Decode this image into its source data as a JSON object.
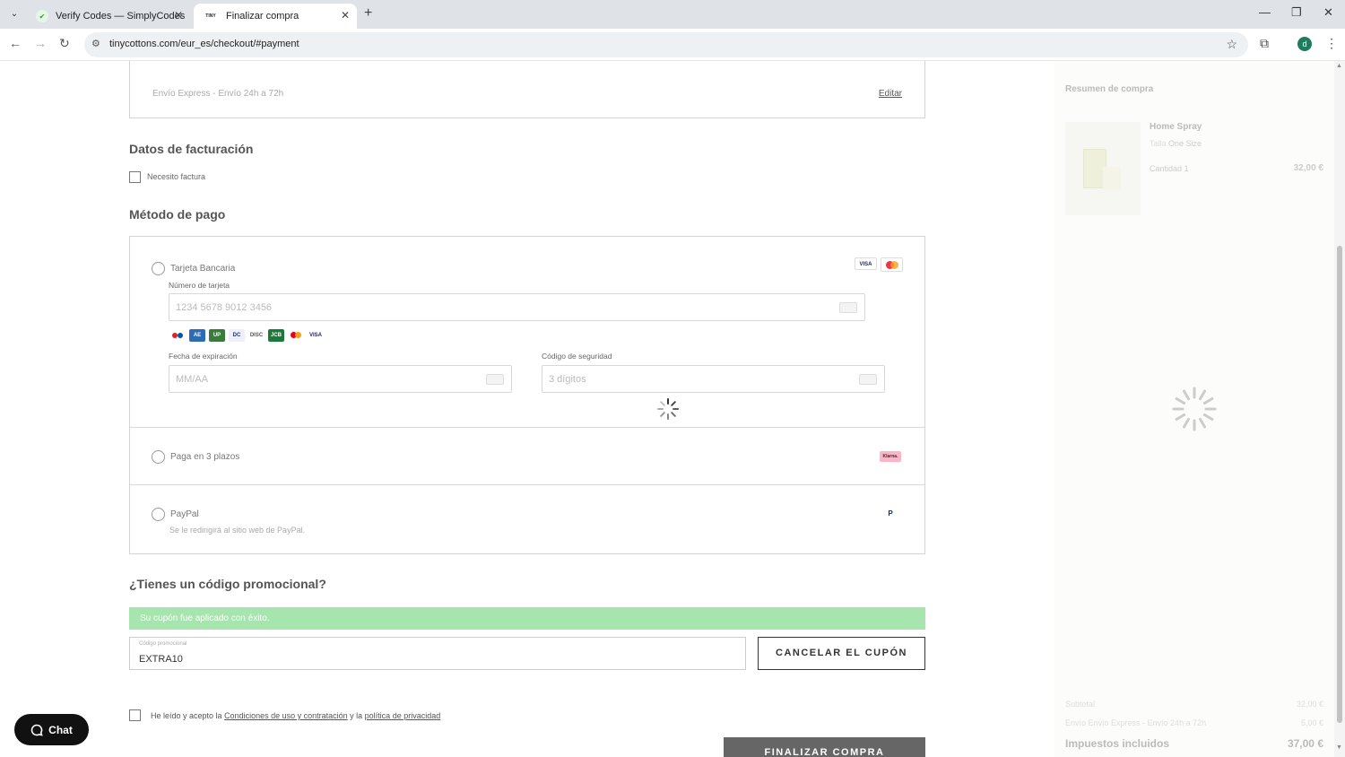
{
  "browser": {
    "tabs": [
      {
        "title": "Verify Codes — SimplyCodes",
        "favicon": "simplycodes-shield-icon"
      },
      {
        "title": "Finalizar compra",
        "favicon": "tinycottons-logo-icon",
        "favicon_text": "TINY"
      }
    ],
    "url": "tinycottons.com/eur_es/checkout/#payment",
    "profile_initial": "d"
  },
  "shipping": {
    "method_text": "Envío Express - Envío 24h a 72h",
    "edit_label": "Editar"
  },
  "billing": {
    "title": "Datos de facturación",
    "need_invoice_label": "Necesito factura"
  },
  "payment": {
    "title": "Método de pago",
    "card": {
      "label": "Tarjeta Bancaria",
      "number_label": "Número de tarjeta",
      "number_placeholder": "1234 5678 9012 3456",
      "expiry_label": "Fecha de expiración",
      "expiry_placeholder": "MM/AA",
      "cvc_label": "Código de seguridad",
      "cvc_placeholder": "3 dígitos",
      "header_brands": [
        "VISA",
        "Mastercard"
      ],
      "accepted_brands": [
        "Maestro",
        "AMEX",
        "UnionPay",
        "Diners",
        "Discover",
        "JCB",
        "Mastercard",
        "VISA"
      ]
    },
    "klarna": {
      "label": "Paga en 3 plazos",
      "badge": "Klarna."
    },
    "paypal": {
      "label": "PayPal",
      "note": "Se le redirigirá al sitio web de PayPal.",
      "badge": "P"
    }
  },
  "promo": {
    "title": "¿Tienes un código promocional?",
    "success_message": "Su cupón fue aplicado con éxito.",
    "field_label": "Código promocional",
    "code_value": "EXTRA10",
    "cancel_label": "CANCELAR EL CUPÓN"
  },
  "terms": {
    "prefix": "He leído y acepto la ",
    "link1": "Condiciones de uso y contratación",
    "middle": " y la ",
    "link2": "política de privacidad"
  },
  "finish_label": "FINALIZAR COMPRA",
  "chat_label": "Chat",
  "summary": {
    "title": "Resumen de compra",
    "product_name": "Home Spray",
    "size_label": "Talla",
    "size_value": "One Size",
    "qty_label": "Cantidad",
    "qty_value": "1",
    "product_price": "32,00 €",
    "subtotal_label": "Subtotal",
    "subtotal_value": "32,00 €",
    "shipping_label": "Envío Envío Express - Envío 24h a 72h",
    "shipping_value": "5,00 €",
    "taxes_label": "Impuestos incluidos",
    "total_value": "37,00 €"
  },
  "colors": {
    "success_bg": "#a6e5ae",
    "finish_btn": "#666666",
    "chat_btn": "#111111"
  }
}
